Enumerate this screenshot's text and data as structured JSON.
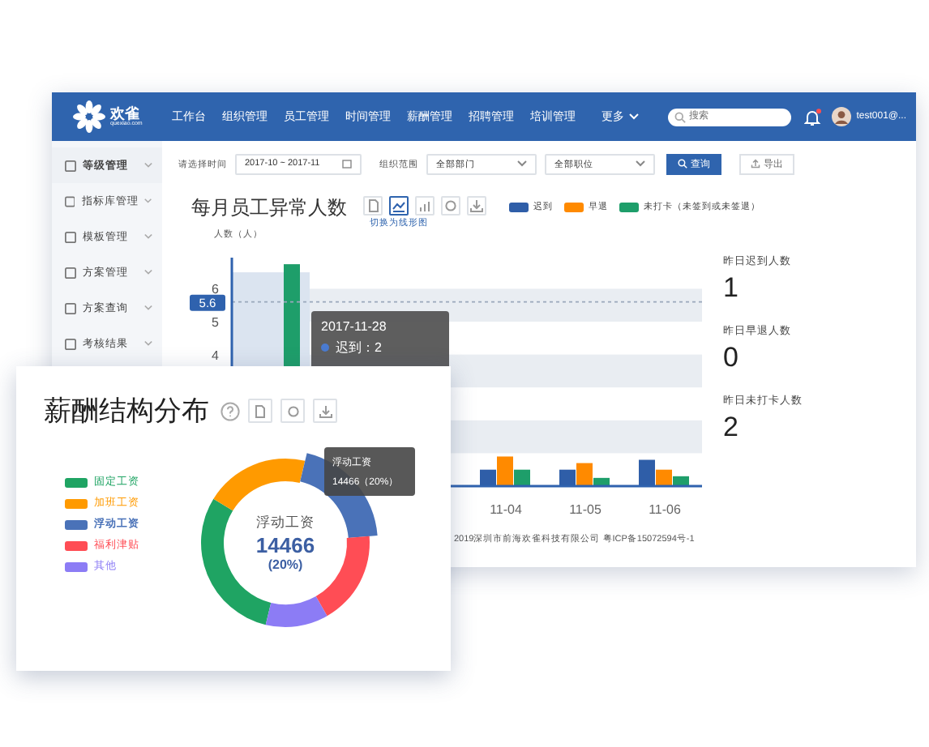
{
  "header": {
    "logo_text": "欢雀",
    "logo_sub": "quexiao.com",
    "nav": [
      {
        "label": "工作台",
        "selected": false
      },
      {
        "label": "组织管理",
        "selected": false
      },
      {
        "label": "员工管理",
        "selected": false
      },
      {
        "label": "时间管理",
        "selected": false
      },
      {
        "label": "薪酬管理",
        "selected": false
      },
      {
        "label": "招聘管理",
        "selected": false
      },
      {
        "label": "培训管理",
        "selected": false
      },
      {
        "label": "更多",
        "selected": false
      }
    ],
    "search": {
      "placeholder": "搜索"
    },
    "notification": true,
    "user": "test001@..."
  },
  "sidebar": {
    "items": [
      {
        "label": "等级管理",
        "selected": true
      },
      {
        "label": "指标库管理",
        "selected": false
      },
      {
        "label": "模板管理",
        "selected": false
      },
      {
        "label": "方案管理",
        "selected": false
      },
      {
        "label": "方案查询",
        "selected": false
      },
      {
        "label": "考核结果",
        "selected": false
      }
    ]
  },
  "filters": {
    "time_label": "请选择时间",
    "time_value": "2017-10 ~ 2017-11",
    "org_label": "组织范围",
    "department": "全部部门",
    "position": "全部职位",
    "query_button": "查询",
    "export_button": "导出"
  },
  "attendance": {
    "title": "每月员工异常人数",
    "switch_hint": "切换为线形图",
    "line_toggle_selected": true,
    "legend": [
      {
        "label": "迟到",
        "color": "#2f5ea8"
      },
      {
        "label": "早退",
        "color": "#ff8a00"
      },
      {
        "label": "未打卡（未签到或未签退）",
        "color": "#1e9e6a"
      }
    ],
    "y_axis_label": "人数（人）",
    "y_ticks": [
      "6",
      "5",
      "4"
    ],
    "x_labels": [
      "11-04",
      "11-05",
      "11-06"
    ],
    "pointer": "5.6",
    "hover": {
      "date": "2017-11-28",
      "lines": [
        {
          "label": "迟到：2",
          "color": "#4a7bd0"
        }
      ]
    }
  },
  "stats": [
    {
      "label": "昨日迟到人数",
      "value": "1"
    },
    {
      "label": "昨日早退人数",
      "value": "0"
    },
    {
      "label": "昨日未打卡人数",
      "value": "2"
    }
  ],
  "footer": "2019深圳市前海欢雀科技有限公司 粤ICP备15072594号-1",
  "salary": {
    "title": "薪酬结构分布",
    "legend": [
      {
        "color": "#1fa463",
        "selected": false
      },
      {
        "color": "#ff9a00",
        "selected": false
      },
      {
        "color": "#4a72b8",
        "selected": true
      },
      {
        "color": "#ff4d55",
        "selected": false
      },
      {
        "color": "#8c7cf5",
        "selected": false
      }
    ],
    "center": {
      "label": "浮动工资",
      "value": "14466",
      "percent": "(20%)"
    },
    "tooltip": {
      "label": "浮动工资",
      "value": "14466（20%）"
    },
    "chart_data": {
      "type": "donut",
      "categories": [
        "固定工资",
        "加班工资",
        "浮动工资",
        "福利津贴",
        "其他"
      ],
      "values": [
        30,
        20,
        20,
        18,
        12
      ]
    }
  }
}
